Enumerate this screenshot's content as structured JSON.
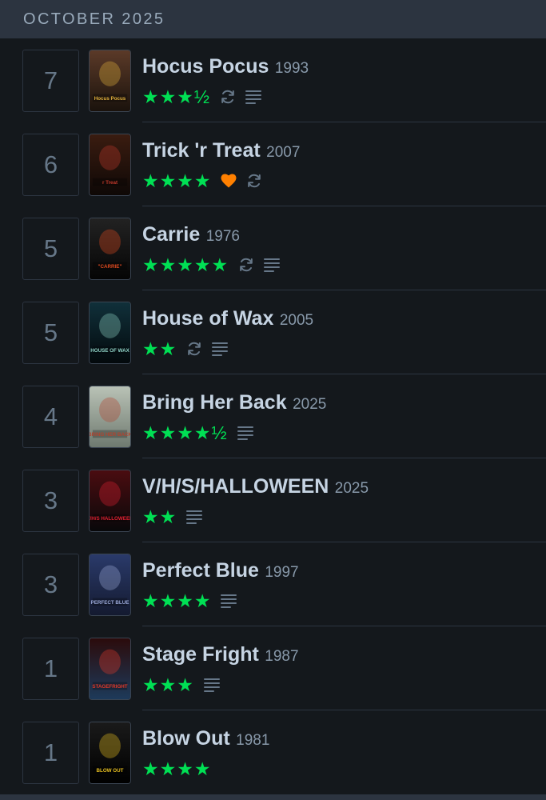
{
  "month": {
    "title": "OCTOBER 2025"
  },
  "entries": [
    {
      "day": "7",
      "title": "Hocus Pocus",
      "year": "1993",
      "rating": "★★★½",
      "stars": 3.5,
      "liked": false,
      "rewatch": true,
      "review": true,
      "poster": {
        "label": "Hocus Pocus",
        "top": "#5b3a28",
        "bottom": "#1a120c",
        "accent": "#e3b23c"
      }
    },
    {
      "day": "6",
      "title": "Trick 'r Treat",
      "year": "2007",
      "rating": "★★★★",
      "stars": 4,
      "liked": true,
      "rewatch": true,
      "review": false,
      "poster": {
        "label": "r Treat",
        "top": "#3a1c10",
        "bottom": "#0e0806",
        "accent": "#c0392b"
      }
    },
    {
      "day": "5",
      "title": "Carrie",
      "year": "1976",
      "rating": "★★★★★",
      "stars": 5,
      "liked": false,
      "rewatch": true,
      "review": true,
      "poster": {
        "label": "\"CARRIE\"",
        "top": "#222222",
        "bottom": "#050505",
        "accent": "#e04a1f"
      }
    },
    {
      "day": "5",
      "title": "House of Wax",
      "year": "2005",
      "rating": "★★",
      "stars": 2,
      "liked": false,
      "rewatch": true,
      "review": true,
      "poster": {
        "label": "HOUSE OF WAX",
        "top": "#10303a",
        "bottom": "#03090c",
        "accent": "#8fd3c7"
      }
    },
    {
      "day": "4",
      "title": "Bring Her Back",
      "year": "2025",
      "rating": "★★★★½",
      "stars": 4.5,
      "liked": false,
      "rewatch": false,
      "review": true,
      "poster": {
        "label": "BRING HER BACK",
        "top": "#b9c2b6",
        "bottom": "#6f7a70",
        "accent": "#b2432e"
      }
    },
    {
      "day": "3",
      "title": "V/H/S/HALLOWEEN",
      "year": "2025",
      "rating": "★★",
      "stars": 2,
      "liked": false,
      "rewatch": false,
      "review": true,
      "poster": {
        "label": "V/H/S HALLOWEEN",
        "top": "#4a0c10",
        "bottom": "#08080a",
        "accent": "#e02030"
      }
    },
    {
      "day": "3",
      "title": "Perfect Blue",
      "year": "1997",
      "rating": "★★★★",
      "stars": 4,
      "liked": false,
      "rewatch": false,
      "review": true,
      "poster": {
        "label": "PERFECT BLUE",
        "top": "#2a3a6a",
        "bottom": "#141a30",
        "accent": "#9aa8d8"
      }
    },
    {
      "day": "1",
      "title": "Stage Fright",
      "year": "1987",
      "rating": "★★★",
      "stars": 3,
      "liked": false,
      "rewatch": false,
      "review": true,
      "poster": {
        "label": "STAGEFRIGHT",
        "top": "#2b0b0b",
        "bottom": "#1d3a5a",
        "accent": "#e23a2a"
      }
    },
    {
      "day": "1",
      "title": "Blow Out",
      "year": "1981",
      "rating": "★★★★",
      "stars": 4,
      "liked": false,
      "rewatch": false,
      "review": false,
      "poster": {
        "label": "BLOW OUT",
        "top": "#1a1a1a",
        "bottom": "#000000",
        "accent": "#e8c020"
      }
    }
  ],
  "colors": {
    "page_bg": "#14181c",
    "header_bg": "#2c3440",
    "star_green": "#00e054",
    "like_orange": "#ff8000",
    "icon_grey": "#678"
  },
  "icons": {
    "rewatch": "rewatch-icon",
    "review": "review-icon",
    "like": "heart-icon"
  }
}
